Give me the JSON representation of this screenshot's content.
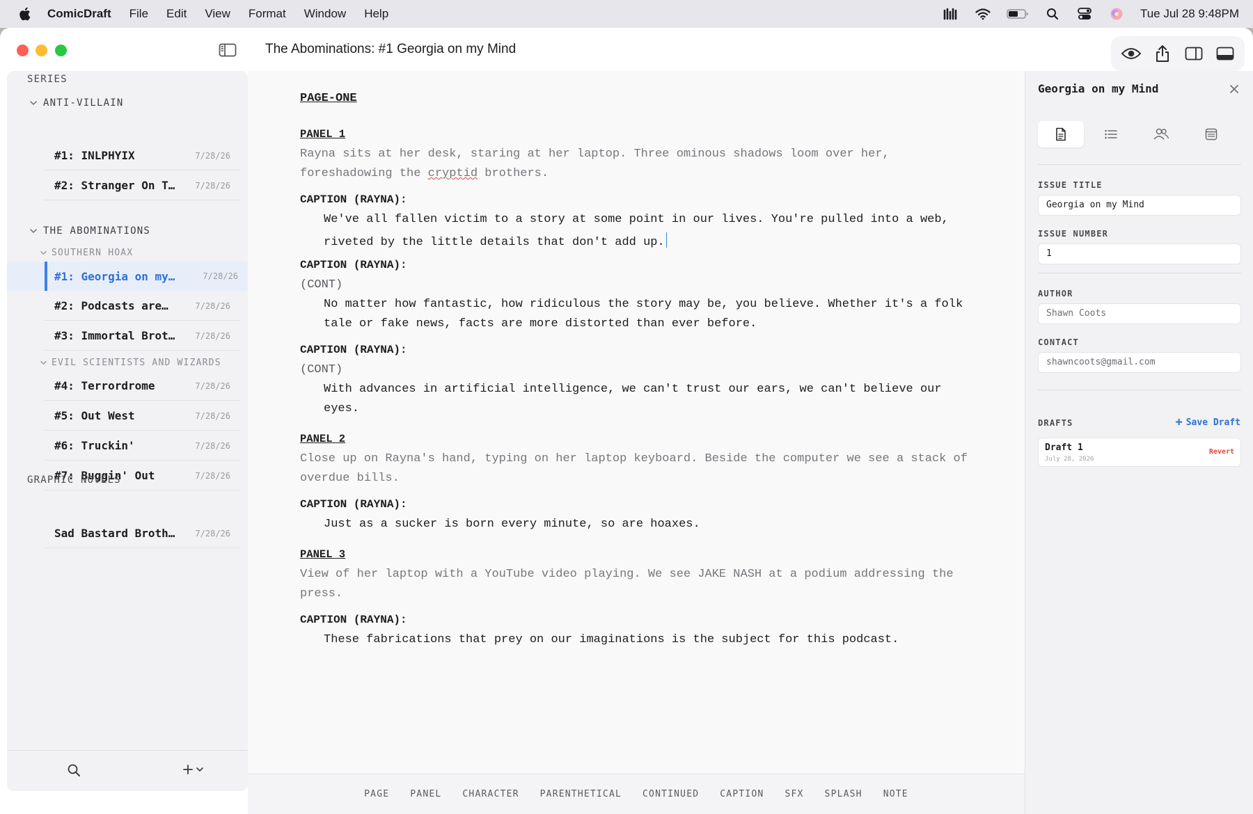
{
  "menubar": {
    "app_name": "ComicDraft",
    "items": [
      "File",
      "Edit",
      "View",
      "Format",
      "Window",
      "Help"
    ],
    "clock": "Tue Jul 28  9:48PM"
  },
  "window": {
    "title": "The Abominations: #1 Georgia on my Mind"
  },
  "sidebar": {
    "series_heading": "SERIES",
    "groups": [
      {
        "name": "ANTI-VILLAIN",
        "items": [
          {
            "label": "#1: INLPHYIX",
            "date": "7/28/26"
          },
          {
            "label": "#2: Stranger On T…",
            "date": "7/28/26"
          }
        ]
      },
      {
        "name": "THE ABOMINATIONS",
        "subgroups": [
          {
            "name": "SOUTHERN HOAX",
            "items": [
              {
                "label": "#1: Georgia on my…",
                "date": "7/28/26",
                "selected": true
              },
              {
                "label": "#2: Podcasts are…",
                "date": "7/28/26"
              },
              {
                "label": "#3: Immortal Brot…",
                "date": "7/28/26"
              }
            ]
          },
          {
            "name": "EVIL SCIENTISTS AND WIZARDS",
            "items": [
              {
                "label": "#4: Terrordrome",
                "date": "7/28/26"
              },
              {
                "label": "#5: Out West",
                "date": "7/28/26"
              },
              {
                "label": "#6: Truckin'",
                "date": "7/28/26"
              },
              {
                "label": "#7: Buggin' Out",
                "date": "7/28/26"
              }
            ]
          }
        ]
      }
    ],
    "graphic_novels_heading": "GRAPHIC NOVELS",
    "graphic_novels": [
      {
        "label": "Sad Bastard Broth…",
        "date": "7/28/26"
      }
    ]
  },
  "script": {
    "page_heading": "PAGE-ONE",
    "panel1": {
      "heading": "PANEL 1",
      "desc_line1": "Rayna sits at her desk, staring at her laptop. Three ominous shadows loom over her,",
      "desc_line2_pre": "foreshadowing the ",
      "desc_line2_misspelled": "cryptid",
      "desc_line2_post": " brothers.",
      "caption1": "CAPTION (RAYNA):",
      "dialog1_line1": "We've all fallen victim to a story at some point in our lives. You're pulled into a web,",
      "dialog1_line2": "riveted by the little details that don't add up.",
      "caption2": "CAPTION (RAYNA):",
      "paren2": "(CONT)",
      "dialog2_line1": "No matter how fantastic, how ridiculous the story may be, you believe. Whether it's a folk",
      "dialog2_line2": "tale or fake news, facts are more distorted than ever before.",
      "caption3": "CAPTION (RAYNA):",
      "paren3": "(CONT)",
      "dialog3_line1": "With advances in artificial intelligence, we can't trust our ears, we can't believe our",
      "dialog3_line2": "eyes."
    },
    "panel2": {
      "heading": "PANEL 2",
      "desc_line1": "Close up on Rayna's hand, typing on her laptop keyboard. Beside the computer we see a stack of",
      "desc_line2": "overdue bills.",
      "caption": "CAPTION (RAYNA):",
      "dialog": "Just as a sucker is born every minute, so are hoaxes."
    },
    "panel3": {
      "heading": "PANEL 3",
      "desc_line1": "View of her laptop with a YouTube video playing. We see JAKE NASH at a podium addressing the",
      "desc_line2": "press.",
      "caption": "CAPTION (RAYNA):",
      "dialog": "These fabrications that prey on our imaginations is the subject for this podcast."
    }
  },
  "element_bar": [
    "PAGE",
    "PANEL",
    "CHARACTER",
    "PARENTHETICAL",
    "CONTINUED",
    "CAPTION",
    "SFX",
    "SPLASH",
    "NOTE"
  ],
  "inspector": {
    "title": "Georgia on my Mind",
    "tabs": [
      "document-icon",
      "list-icon",
      "people-icon",
      "notes-icon"
    ],
    "issue_title_label": "ISSUE TITLE",
    "issue_title_value": "Georgia on my Mind",
    "issue_number_label": "ISSUE NUMBER",
    "issue_number_value": "1",
    "author_label": "AUTHOR",
    "author_value": "Shawn Coots",
    "contact_label": "CONTACT",
    "contact_value": "shawncoots@gmail.com",
    "drafts_label": "DRAFTS",
    "save_draft_label": "Save Draft",
    "drafts": [
      {
        "name": "Draft 1",
        "date": "July 28, 2026",
        "action": "Revert"
      }
    ]
  },
  "colors": {
    "accent": "#2f6fd6",
    "selection_bg": "#e8eef9",
    "destructive": "#e0483e",
    "traffic_red": "#fe5f57",
    "traffic_yellow": "#febc2e",
    "traffic_green": "#28c840"
  }
}
